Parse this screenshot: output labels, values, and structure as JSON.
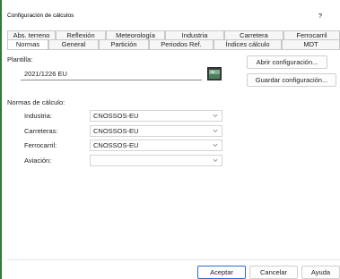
{
  "window": {
    "title": "Configuración de cálculos",
    "help_label": "?"
  },
  "tabs_row1": [
    {
      "label": "Abs. terreno",
      "active": false
    },
    {
      "label": "Reflexión",
      "active": false
    },
    {
      "label": "Meteorología",
      "active": false
    },
    {
      "label": "Industria",
      "active": false
    },
    {
      "label": "Carretera",
      "active": false
    },
    {
      "label": "Ferrocarril",
      "active": false
    }
  ],
  "tabs_row2": [
    {
      "label": "Normas",
      "active": true
    },
    {
      "label": "General",
      "active": false
    },
    {
      "label": "Partición",
      "active": false
    },
    {
      "label": "Periodos Ref.",
      "active": false
    },
    {
      "label": "Índices cálculo",
      "active": false
    },
    {
      "label": "MDT",
      "active": false
    }
  ],
  "plantilla": {
    "label": "Plantilla:",
    "value": "2021/1226 EU",
    "open_button": "Abrir configuración...",
    "save_button": "Guardar configuración..."
  },
  "normas": {
    "label": "Normas de cálculo:",
    "rows": [
      {
        "label": "Industria:",
        "value": "CNOSSOS-EU"
      },
      {
        "label": "Carreteras:",
        "value": "CNOSSOS-EU"
      },
      {
        "label": "Ferrocarril:",
        "value": "CNOSSOS-EU"
      },
      {
        "label": "Aviación:",
        "value": ""
      }
    ]
  },
  "footer": {
    "accept": "Aceptar",
    "cancel": "Cancelar",
    "help": "Ayuda"
  },
  "colors": {
    "accent": "#2e7d32",
    "primary_border": "#2b6cd1"
  },
  "icons": {
    "folder": "folder-icon",
    "chevron": "chevron-down-icon"
  }
}
